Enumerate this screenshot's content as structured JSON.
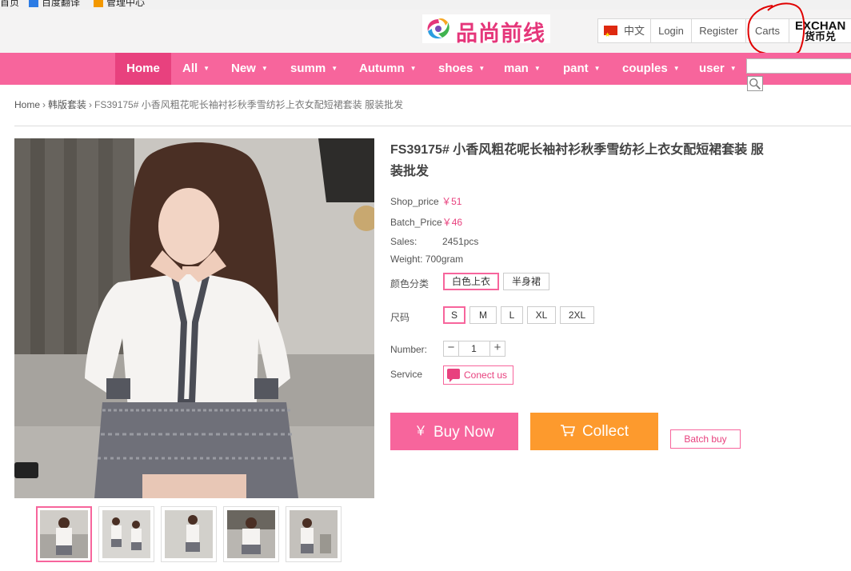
{
  "bookmarks": [
    {
      "label": "首页",
      "icon": "home-bookmark"
    },
    {
      "label": "百度翻译",
      "icon": "baidu-translate-icon"
    },
    {
      "label": "管理中心",
      "icon": "cart-icon"
    }
  ],
  "header": {
    "logo_text": "品尚前线",
    "language": "中文",
    "login": "Login",
    "register": "Register",
    "carts": "Carts",
    "exchange": "EXCHAN",
    "exchange_sub": "货币兑"
  },
  "nav": {
    "items": [
      {
        "label": "Home",
        "active": true,
        "dropdown": false
      },
      {
        "label": "All",
        "dropdown": true
      },
      {
        "label": "New",
        "dropdown": true
      },
      {
        "label": "summ",
        "dropdown": true
      },
      {
        "label": "Autumn",
        "dropdown": true
      },
      {
        "label": "shoes",
        "dropdown": true
      },
      {
        "label": "man",
        "dropdown": true
      },
      {
        "label": "pant",
        "dropdown": true
      },
      {
        "label": "couples",
        "dropdown": true
      },
      {
        "label": "user",
        "dropdown": true
      }
    ],
    "search_placeholder": ""
  },
  "breadcrumb": {
    "home": "Home",
    "sep": "›",
    "category": "韩版套装",
    "current": "FS39175# 小香风粗花呢长袖衬衫秋季雪纺衫上衣女配短裙套装 服装批发"
  },
  "product": {
    "title": "FS39175# 小香风粗花呢长袖衬衫秋季雪纺衫上衣女配短裙套装 服装批发",
    "shop_price_label": "Shop_price",
    "shop_price": "￥51",
    "batch_price_label": "Batch_Price",
    "batch_price": "￥46",
    "sales_label": "Sales:",
    "sales": "2451pcs",
    "weight": "Weight: 700gram",
    "color_label": "颜色分类",
    "colors": [
      {
        "label": "白色上衣",
        "selected": true
      },
      {
        "label": "半身裙",
        "selected": false
      }
    ],
    "size_label": "尺码",
    "sizes": [
      {
        "label": "S",
        "selected": true
      },
      {
        "label": "M",
        "selected": false
      },
      {
        "label": "L",
        "selected": false
      },
      {
        "label": "XL",
        "selected": false
      },
      {
        "label": "2XL",
        "selected": false
      }
    ],
    "number_label": "Number:",
    "quantity": "1",
    "minus": "−",
    "plus": "+",
    "service_label": "Service",
    "contact": "Conect us",
    "buy_now": "Buy Now",
    "buy_icon": "￥",
    "collect": "Collect",
    "batch_buy": "Batch buy"
  },
  "gallery": {
    "thumbnail_count": 5,
    "active_thumbnail": 1
  },
  "colors": {
    "nav_pink": "#f7659c",
    "nav_active": "#e8417e",
    "collect_orange": "#fd9a2d",
    "annotation_red": "#e00000"
  }
}
